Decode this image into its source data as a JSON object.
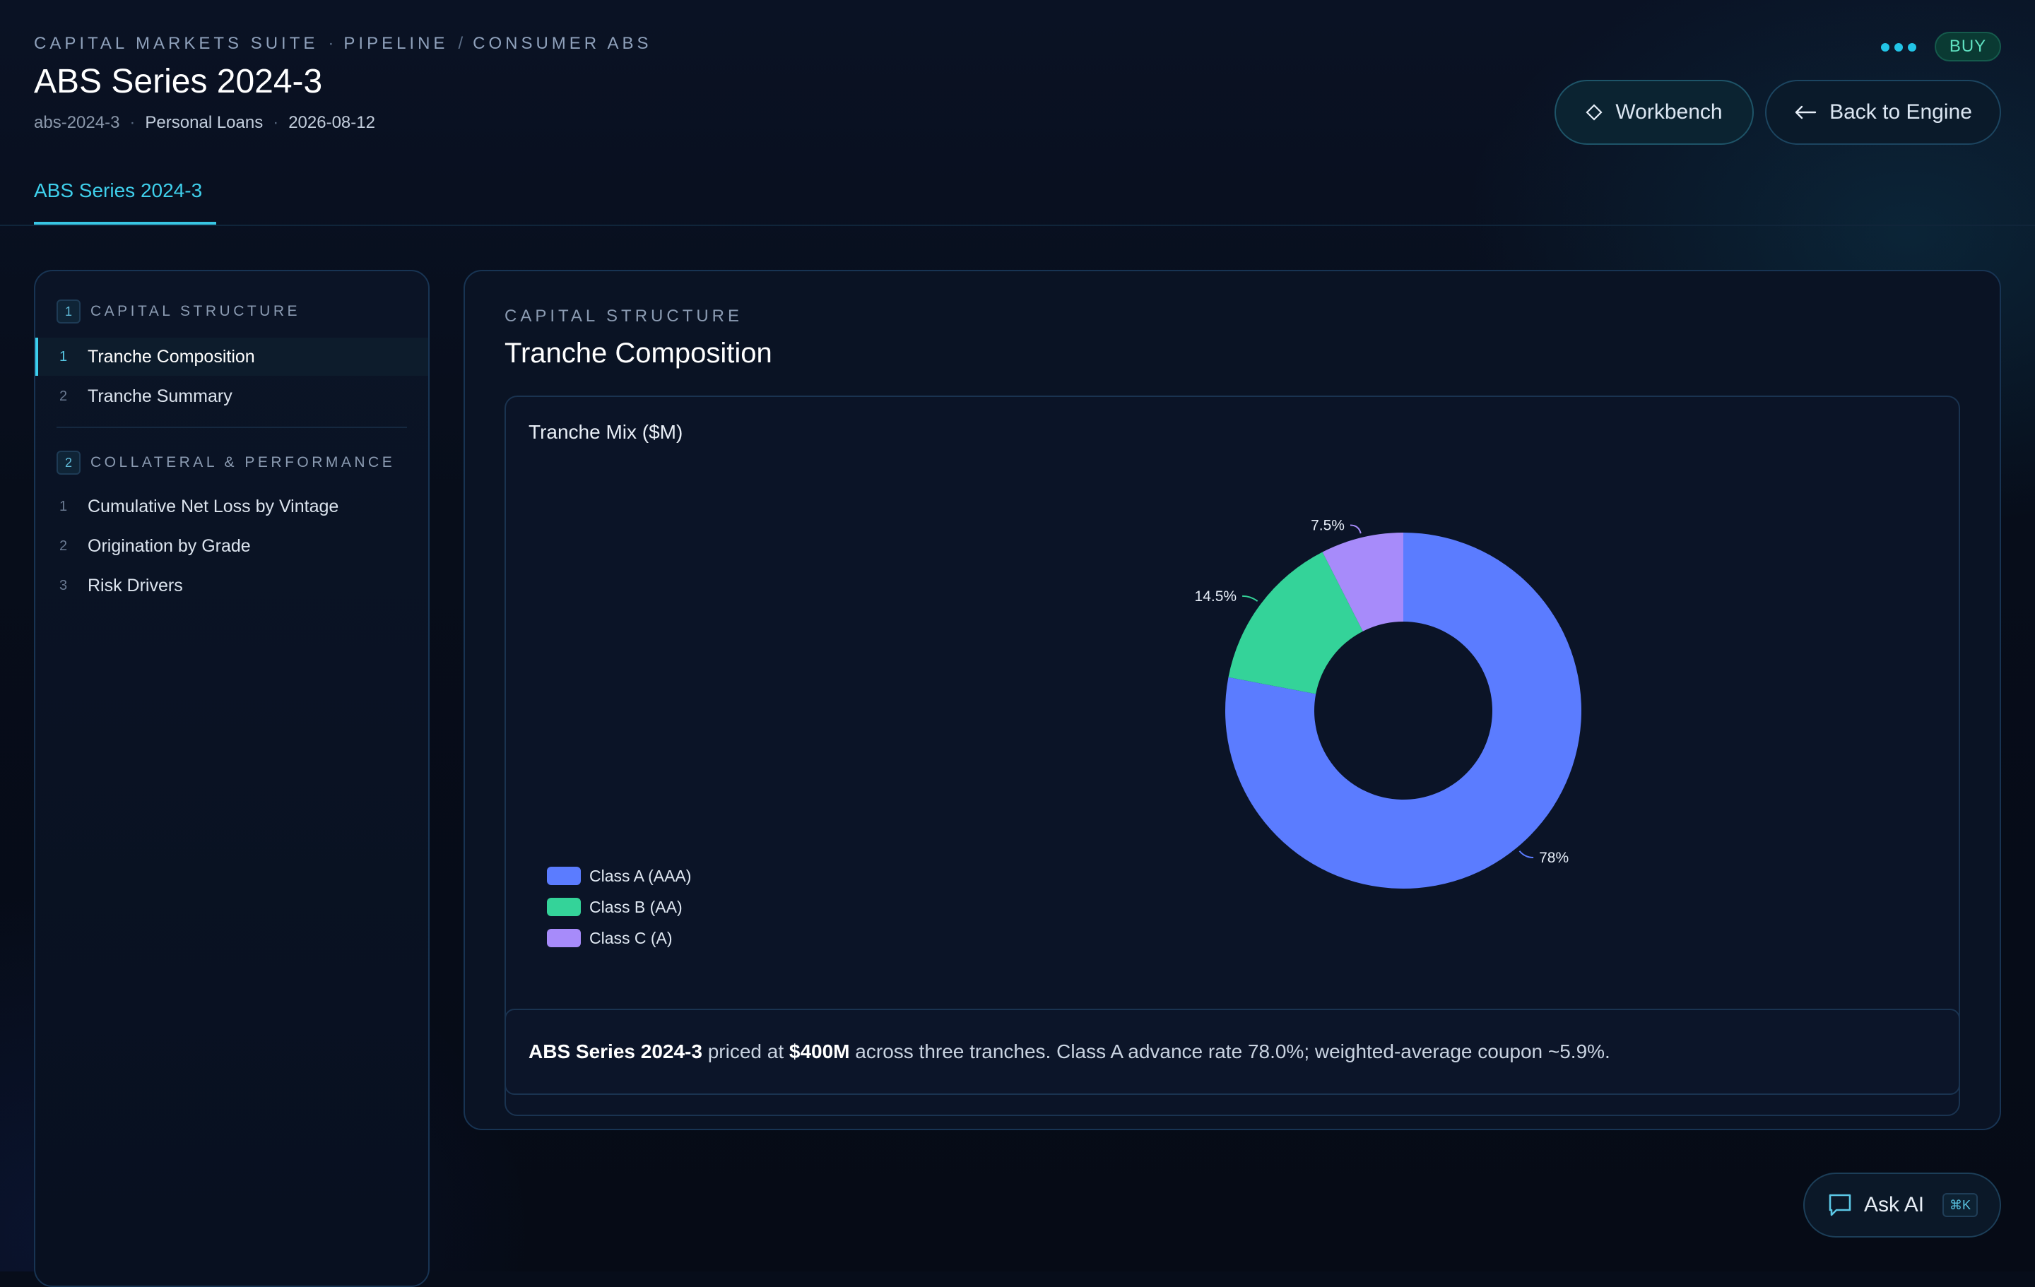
{
  "header": {
    "breadcrumb": [
      "CAPITAL MARKETS SUITE",
      "PIPELINE",
      "CONSUMER ABS"
    ],
    "breadcrumb_dot": "·",
    "breadcrumb_slash": "/",
    "title": "ABS Series 2024-3",
    "meta": {
      "id": "abs-2024-3",
      "asset_class": "Personal Loans",
      "date": "2026-08-12",
      "separator": "·"
    },
    "tab": "ABS Series 2024-3",
    "badge": "BUY",
    "workbench_label": "Workbench",
    "back_label": "Back to Engine"
  },
  "sidebar": {
    "sections": [
      {
        "number": "1",
        "label": "CAPITAL STRUCTURE",
        "items": [
          {
            "number": "1",
            "label": "Tranche Composition",
            "active": true
          },
          {
            "number": "2",
            "label": "Tranche Summary",
            "active": false
          }
        ]
      },
      {
        "number": "2",
        "label": "COLLATERAL & PERFORMANCE",
        "items": [
          {
            "number": "1",
            "label": "Cumulative Net Loss by Vintage",
            "active": false
          },
          {
            "number": "2",
            "label": "Origination by Grade",
            "active": false
          },
          {
            "number": "3",
            "label": "Risk Drivers",
            "active": false
          }
        ]
      }
    ]
  },
  "main": {
    "eyebrow": "CAPITAL STRUCTURE",
    "title": "Tranche Composition",
    "summary": {
      "name": "ABS Series 2024-3",
      "t1": " priced at ",
      "amount": "$400M",
      "t2": " across three tranches. Class A advance rate 78.0%; weighted-average coupon ~5.9%."
    }
  },
  "chart_data": {
    "type": "pie",
    "title": "Tranche Mix ($M)",
    "categories": [
      "Class A (AAA)",
      "Class B (AA)",
      "Class C (A)"
    ],
    "values": [
      312,
      58,
      30
    ],
    "percent_labels": [
      "78%",
      "14.5%",
      "7.5%"
    ],
    "colors": [
      "#5b7cff",
      "#34d399",
      "#a78bfa"
    ],
    "legend_position": "bottom-left",
    "donut": true
  },
  "ask_ai": {
    "label": "Ask AI",
    "shortcut": "⌘K"
  }
}
